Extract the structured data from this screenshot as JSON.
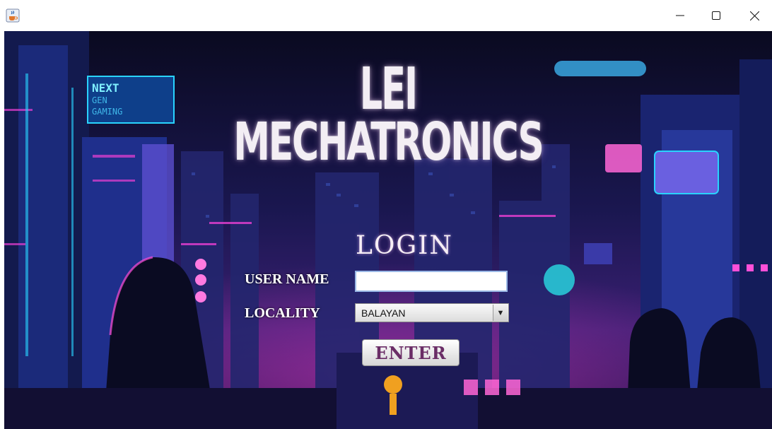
{
  "window": {
    "app_icon": "java-cup-icon",
    "controls": {
      "minimize": "minimize-icon",
      "maximize": "maximize-icon",
      "close": "close-icon"
    }
  },
  "banner": {
    "title_line1": "LEI",
    "title_line2": "MECHATRONICS"
  },
  "login": {
    "heading": "LOGIN",
    "username_label": "USER NAME",
    "username_value": "",
    "locality_label": "LOCALITY",
    "locality_selected": "BALAYAN",
    "enter_label": "ENTER"
  },
  "colors": {
    "accent_pink": "#e83fd2",
    "accent_cyan": "#29d3ff",
    "night_blue": "#1a1c5c",
    "enter_text": "#6a2d66"
  }
}
